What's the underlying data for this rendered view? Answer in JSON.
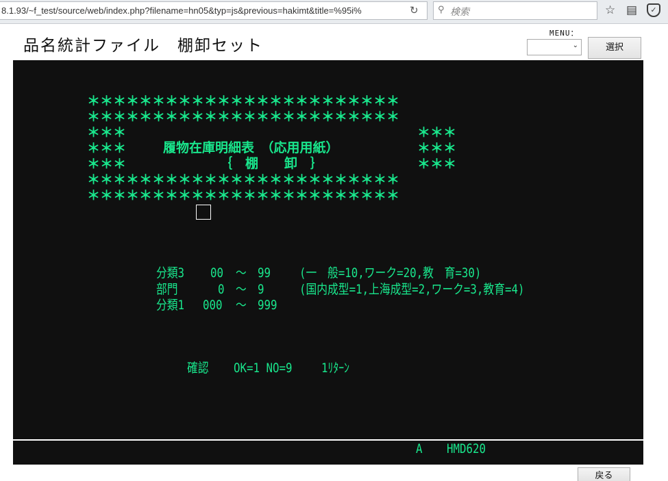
{
  "browser": {
    "url": "8.1.93/~f_test/source/web/index.php?filename=hn05&typ=js&previous=hakimt&title=%95i%",
    "search_placeholder": "検索",
    "reload_icon": "reload-icon",
    "bookmark_icon": "star-icon",
    "reader_icon": "reader-icon",
    "pocket_icon": "pocket-icon"
  },
  "header": {
    "title": "品名統計ファイル　棚卸セット",
    "menu_label": "MENU：",
    "menu_selected": "",
    "select_button": "選択"
  },
  "terminal": {
    "foreground": "#19e68c",
    "background": "#101010",
    "banner": {
      "stars_full": "＊＊＊＊＊＊＊＊＊＊＊＊＊＊＊＊＊＊＊＊＊＊＊＊",
      "stars_side": "＊＊＊",
      "line1": "履物在庫明細表　（応用用紙）",
      "line2": "｛　棚　　卸　｝"
    },
    "fields": [
      {
        "label": "分類3",
        "from": "00",
        "tilde": "～",
        "to": "99",
        "note": "(一　般=10,ワーク=20,教　育=30)"
      },
      {
        "label": "部門",
        "from": "0",
        "tilde": "～",
        "to": "9",
        "note": "(国内成型=1,上海成型=2,ワーク=3,教育=4)"
      },
      {
        "label": "分類1",
        "from": "000",
        "tilde": "～",
        "to": "999",
        "note": ""
      }
    ],
    "confirm": {
      "label": "確認",
      "text": "OK=1 NO=9",
      "hint": "1ﾘﾀｰﾝ"
    }
  },
  "status_bar": {
    "mode": "A",
    "program": "HMD620"
  },
  "footer": {
    "back_button": "戻る"
  }
}
